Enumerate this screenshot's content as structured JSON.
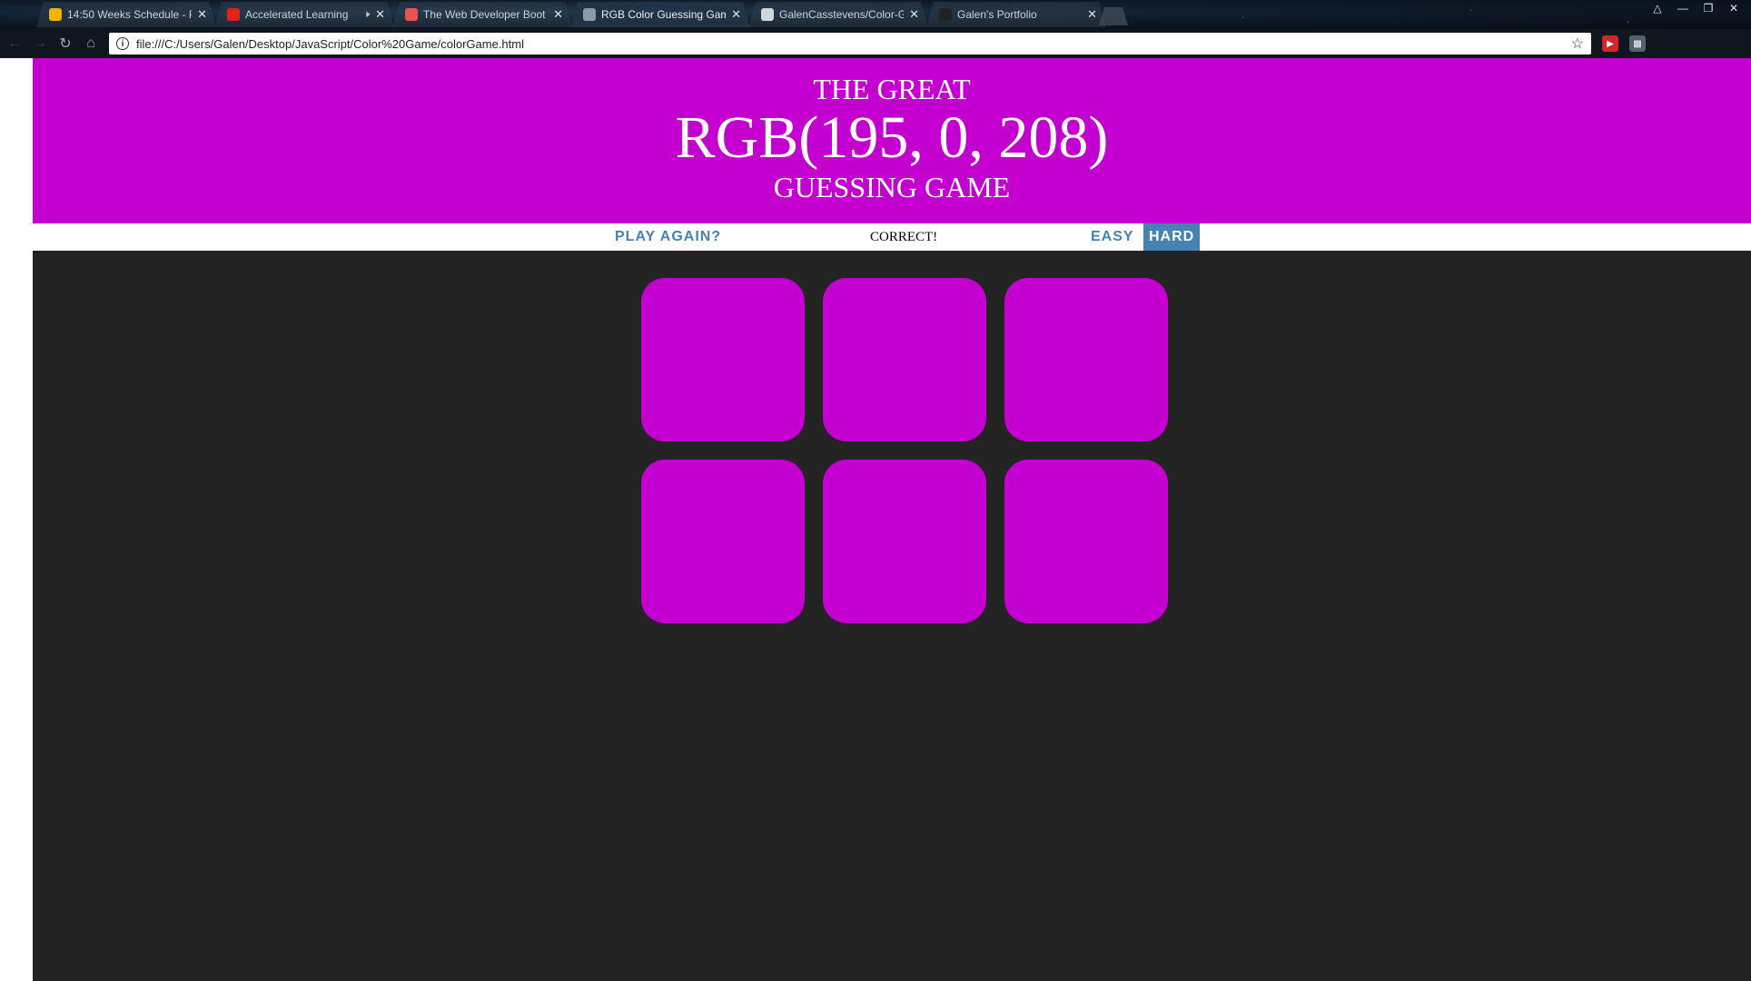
{
  "browser": {
    "tabs": [
      {
        "title": "14:50 Weeks Schedule - F",
        "favicon_color": "#f2b400",
        "active": false
      },
      {
        "title": "Accelerated Learning",
        "favicon_color": "#e62117",
        "active": false,
        "muted": true
      },
      {
        "title": "The Web Developer Boot",
        "favicon_color": "#ec5252",
        "active": false
      },
      {
        "title": "RGB Color Guessing Gam",
        "favicon_color": "#8a9aa8",
        "active": true
      },
      {
        "title": "GalenCasstevens/Color-G",
        "favicon_color": "#cfd6dc",
        "active": false
      },
      {
        "title": "Galen's Portfolio",
        "favicon_color": "#222222",
        "active": false
      }
    ],
    "address": "file:///C:/Users/Galen/Desktop/JavaScript/Color%20Game/colorGame.html"
  },
  "game": {
    "title_top": "THE GREAT",
    "rgb_display": "RGB(195, 0, 208)",
    "title_bottom": "GUESSING GAME",
    "header_color": "#c300d0",
    "play_again_label": "PLAY AGAIN?",
    "message": "CORRECT!",
    "easy_label": "EASY",
    "hard_label": "HARD",
    "selected_mode": "hard",
    "accent_color": "#4682b4",
    "background_color": "#232323",
    "squares": [
      "#c300d0",
      "#c300d0",
      "#c300d0",
      "#c300d0",
      "#c300d0",
      "#c300d0"
    ]
  }
}
